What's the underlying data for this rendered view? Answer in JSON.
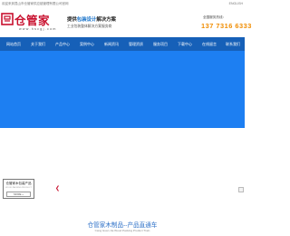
{
  "topbar": {
    "welcome": "欢迎来到昆山市仓管家供应链管理有限公司官网",
    "lang": "ENGLISH"
  },
  "logo": {
    "name": "仓管家",
    "url": "www.hscgj.com"
  },
  "slogan": {
    "prefix": "提供",
    "highlight": "包装设计",
    "suffix": "解决方案",
    "sub": "工业包装整体解决方案服务商"
  },
  "hotline": {
    "label": "全国服务热线：",
    "phone": "137 7316 6333"
  },
  "nav": {
    "items": [
      "网站首页",
      "关于我们",
      "产品中心",
      "案例中心",
      "新闻资讯",
      "管理资质",
      "服务项目",
      "下载中心",
      "在线留言",
      "联系我们"
    ]
  },
  "side_box": {
    "title": "仓管家木包装产品",
    "subtitle": "WOOD PACKING PRODUCT",
    "more": "MORE +"
  },
  "section": {
    "title": "仓管家木制品--产品直通车",
    "subtitle": "Cang Guan Jia Wood Packing Product Train"
  },
  "colors": {
    "brand_red": "#c8102e",
    "accent_blue": "#1a73c9",
    "nav_blue": "#1660b8",
    "banner_blue": "#1d7ff2",
    "phone_orange": "#f08c00"
  }
}
